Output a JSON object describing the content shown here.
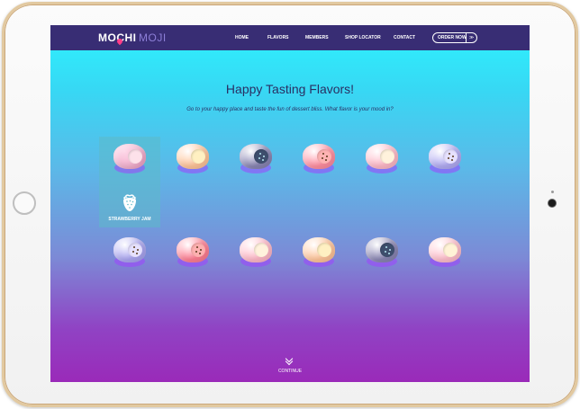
{
  "navbar": {
    "logo_primary": "MOCHI",
    "logo_secondary": "MOJI",
    "links": [
      "HOME",
      "FLAVORS",
      "MEMBERS",
      "SHOP LOCATOR",
      "CONTACT"
    ],
    "order_label": "ORDER NOW",
    "order_icon": "≫"
  },
  "hero": {
    "title": "Happy Tasting Flavors!",
    "subtitle": "Go to your happy place and taste the fun of dessert bliss. What flavor is your mood in?"
  },
  "featured": {
    "label": "STRAWBERRY JAM",
    "icon": "strawberry-icon"
  },
  "flavors_row1": [
    {
      "icon": "mochi-pink-icon",
      "body": "#f7b4d4",
      "filling": "#fde1ea",
      "dots": false
    },
    {
      "icon": "mochi-peach-icon",
      "body": "#ffc59a",
      "filling": "#fff0c2",
      "dots": false
    },
    {
      "icon": "mochi-slate-icon",
      "body": "#8a86b3",
      "filling": "#3e4e6d",
      "dots": true
    },
    {
      "icon": "mochi-red-icon",
      "body": "#ff8fa1",
      "filling": "#ffb3b3",
      "dots": true
    },
    {
      "icon": "mochi-blush-icon",
      "body": "#ffb9c8",
      "filling": "#fff2dc",
      "dots": false
    },
    {
      "icon": "mochi-lavender-icon",
      "body": "#b2acf3",
      "filling": "#e6e1ff",
      "dots": true
    }
  ],
  "flavors_row2": [
    {
      "icon": "mochi-lavender-icon",
      "body": "#aba6f1",
      "filling": "#e6e1ff",
      "dots": true
    },
    {
      "icon": "mochi-red-icon",
      "body": "#ff7f93",
      "filling": "#ffb0b0",
      "dots": true
    },
    {
      "icon": "mochi-blush-icon",
      "body": "#ffb9c8",
      "filling": "#fff2dc",
      "dots": false
    },
    {
      "icon": "mochi-peach-icon",
      "body": "#ffc59a",
      "filling": "#fff0c2",
      "dots": false
    },
    {
      "icon": "mochi-slate-icon",
      "body": "#8a86b3",
      "filling": "#3e4e6d",
      "dots": true
    },
    {
      "icon": "mochi-pink-icon",
      "body": "#ffbfcc",
      "filling": "#fff3d6",
      "dots": false
    }
  ],
  "continue": {
    "label": "CONTINUE",
    "icon": "double-chevron-down-icon"
  },
  "colors": {
    "navbar": "#382d74",
    "accent": "#ff3d88",
    "text": "#2a2f63"
  }
}
